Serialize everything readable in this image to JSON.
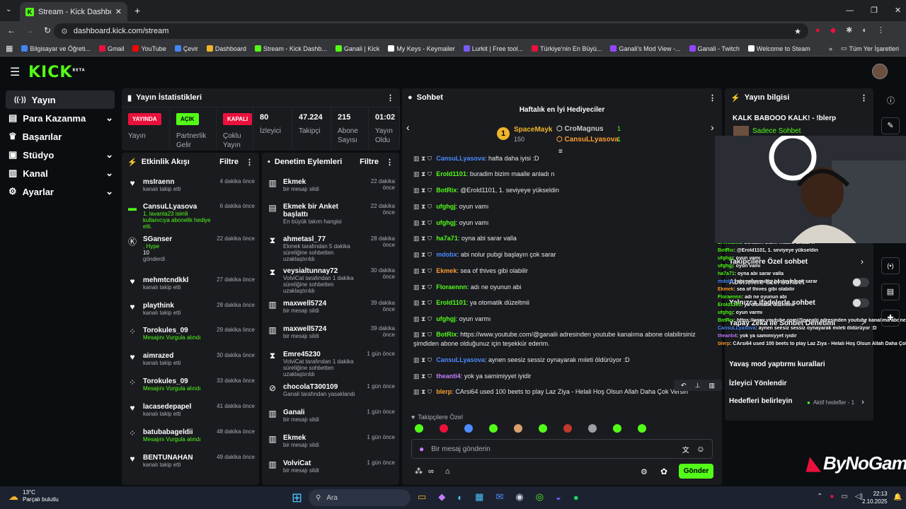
{
  "browser": {
    "tab_title": "Stream - Kick Dashboard",
    "url": "dashboard.kick.com/stream",
    "bookmarks": [
      "Bilgisayar ve Öğreti...",
      "Gmail",
      "YouTube",
      "Çevir",
      "Dashboard",
      "Stream - Kick Dashb...",
      "Ganali | Kick",
      "My Keys - Keymailer",
      "Lurkit | Free tool...",
      "Türkiye'nin En Büyü...",
      "Ganali's Mod View -...",
      "Ganali - Twitch",
      "Welcome to Steam"
    ],
    "all_bookmarks": "Tüm Yer İşaretleri"
  },
  "kick": {
    "logo": "KICK",
    "beta": "BETA"
  },
  "sidebar": {
    "items": [
      {
        "label": "Yayın"
      },
      {
        "label": "Para Kazanma"
      },
      {
        "label": "Başarılar"
      },
      {
        "label": "Stüdyo"
      },
      {
        "label": "Kanal"
      },
      {
        "label": "Ayarlar"
      }
    ]
  },
  "stats": {
    "title": "Yayın İstatistikleri",
    "cells": [
      {
        "badge": "YAYINDA",
        "label": "Yayın",
        "color": "#e9113c"
      },
      {
        "badge": "AÇIK",
        "label": "Partnerlik Gelir",
        "color": "#53fc18"
      },
      {
        "badge": "KAPALI",
        "label": "Çoklu Yayın",
        "color": "#e9113c"
      },
      {
        "value": "80",
        "label": "İzleyici"
      },
      {
        "value": "47.224",
        "label": "Takipçi"
      },
      {
        "value": "215",
        "label": "Abone Sayısı"
      },
      {
        "value": "01:02",
        "label": "Yayın Oldu"
      }
    ]
  },
  "activity": {
    "title": "Etkinlik Akışı",
    "filter": "Filtre",
    "items": [
      {
        "name": "msIraenn",
        "sub": "kanalı takip etti",
        "time": "4 dakika önce"
      },
      {
        "name": "CansuLLyasova",
        "sub": "1, lavanta23 isimli kullanıcıya abonelik hediye etti.",
        "time": "6 dakika önce"
      },
      {
        "name": "SGanser",
        "sub": ", Hype",
        "extra": "10",
        "extra2": "gönderdi",
        "time": "22 dakika önce"
      },
      {
        "name": "mehmtcndkkl",
        "sub": "kanalı takip etti",
        "time": "27 dakika önce"
      },
      {
        "name": "playthink",
        "sub": "kanalı takip etti",
        "time": "28 dakika önce"
      },
      {
        "name": "Torokules_09",
        "sub": "Mesajını Vurgula alındı",
        "time": "29 dakika önce"
      },
      {
        "name": "aimrazed",
        "sub": "kanalı takip etti",
        "time": "30 dakika önce"
      },
      {
        "name": "Torokules_09",
        "sub": "Mesajını Vurgula alındı",
        "time": "33 dakika önce"
      },
      {
        "name": "lacasedepapel",
        "sub": "kanalı takip etti",
        "time": "41 dakika önce"
      },
      {
        "name": "batubabageldii",
        "sub": "Mesajını Vurgula alındı",
        "time": "48 dakika önce"
      },
      {
        "name": "BENTUNAHAN",
        "sub": "kanalı takip etti",
        "time": "49 dakika önce"
      }
    ]
  },
  "moderation": {
    "title": "Denetim Eylemleri",
    "filter": "Filtre",
    "items": [
      {
        "name": "Ekmek",
        "sub": "bir mesajı sildi",
        "time": "22 dakika önce"
      },
      {
        "name": "Ekmek bir Anket başlattı",
        "sub": "En büyük takım hangisi",
        "time": "22 dakika önce"
      },
      {
        "name": "ahmetasl_77",
        "sub": "Ekmek tarafından 5 dakika süreliğine sohbetten uzaklaştırıldı",
        "time": "28 dakika önce"
      },
      {
        "name": "veysialtunnay72",
        "sub": "VolviCat tarafından 1 dakika süreliğine sohbetten uzaklaştırıldı",
        "time": "30 dakika önce"
      },
      {
        "name": "maxwell5724",
        "sub": "bir mesajı sildi",
        "time": "39 dakika önce"
      },
      {
        "name": "maxwell5724",
        "sub": "bir mesajı sildi",
        "time": "39 dakika önce"
      },
      {
        "name": "Emre45230",
        "sub": "VolviCat tarafından 1 dakika süreliğine sohbetten uzaklaştırıldı",
        "time": "1 gün önce"
      },
      {
        "name": "chocolaT300109",
        "sub": "Ganali tarafından yasaklandı",
        "time": "1 gün önce"
      },
      {
        "name": "Ganali",
        "sub": "bir mesajı sildi",
        "time": "1 gün önce"
      },
      {
        "name": "Ekmek",
        "sub": "bir mesajı sildi",
        "time": "1 gün önce"
      },
      {
        "name": "VolviCat",
        "sub": "bir mesajı sildi",
        "time": "1 gün önce"
      }
    ]
  },
  "chat": {
    "title": "Sohbet",
    "gifters_title": "Haftalık en İyi Hediyeciler",
    "gifters": [
      {
        "name": "SpaceMayk",
        "count": "150"
      },
      {
        "name": "CroMagnus",
        "count": "1"
      },
      {
        "name": "CansuLLyasova",
        "count": "1"
      }
    ],
    "messages": [
      {
        "user": "CansuLLyasova",
        "text": ": hafta daha iyisi :D",
        "color": "#4d8bff"
      },
      {
        "user": "Erold1101",
        "text": ": buradim bizim maalle anladı n",
        "color": "#53fc18"
      },
      {
        "user": "BotRix",
        "text": ": @Erold1101, 1. seviyeye yükseldin",
        "color": "#53fc18"
      },
      {
        "user": "ufghgj",
        "text": ": oyun vamı",
        "color": "#53fc18"
      },
      {
        "user": "ufghgj",
        "text": ": oyun vamı",
        "color": "#53fc18"
      },
      {
        "user": "ha7a71",
        "text": ": oyna abi sarar valla",
        "color": "#53fc18"
      },
      {
        "user": "mdobx",
        "text": ": abi nolur pubgi başlayın çok sarar",
        "color": "#4d8bff"
      },
      {
        "user": "Ekmek",
        "text": ": sea of thives gibi olabilir",
        "color": "#ff9f2e"
      },
      {
        "user": "Floraennn",
        "text": ": adı ne oyunun abi",
        "color": "#53fc18"
      },
      {
        "user": "Erold1101",
        "text": ": ya otomatik düzeltmii",
        "color": "#53fc18"
      },
      {
        "user": "ufghgj",
        "text": ": oyun varmı",
        "color": "#53fc18"
      },
      {
        "user": "BotRix",
        "text": ": https://www.youtube.com/@ganalii adresinden youtube kanalıma abone olabilirsiniz şimdiden abone olduğunuz için teşekkür ederim.",
        "color": "#53fc18"
      },
      {
        "user": "CansuLLyasova",
        "text": ": aynen seesiz sessiz oynayarak mıleti öldürüyor :D",
        "color": "#4d8bff"
      },
      {
        "user": "theanti4",
        "text": ": yok ya samimiyyet iyidir",
        "color": "#c47dff"
      },
      {
        "user": "blerp",
        "text": ": CArsi64 used 100 beets to play Laz Ziya - Helali Hoş Olsun Allah Daha Çok Versin",
        "color": "#ff9f2e"
      }
    ],
    "followers_only": "Takipçilere Özel",
    "placeholder": "Bir mesaj gönderin",
    "send": "Gönder"
  },
  "info": {
    "title": "Yayın bilgisi",
    "stream_title": "KALK BABOOO KALK! - !blerp",
    "sub_only": "Sadece Sohbet",
    "rows": [
      "Takipçilere Özel sohbet",
      "Abonelere özel sohbet",
      "Yalnızca ifadelerle sohbet",
      "Yapay Zeka ile Sohbet Denetimi",
      "Yavaş mod yaptırmı kurallari",
      "İzleyici Yönlendir"
    ],
    "goals": "Hedefleri belirleyin",
    "goals_active": "Aktif hedefler - 1"
  },
  "watermark": "ByNoGame",
  "taskbar": {
    "temp": "13°C",
    "weather": "Parçalı bulutlu",
    "search": "Ara",
    "time": "22:13",
    "date": "2.10.2025"
  }
}
